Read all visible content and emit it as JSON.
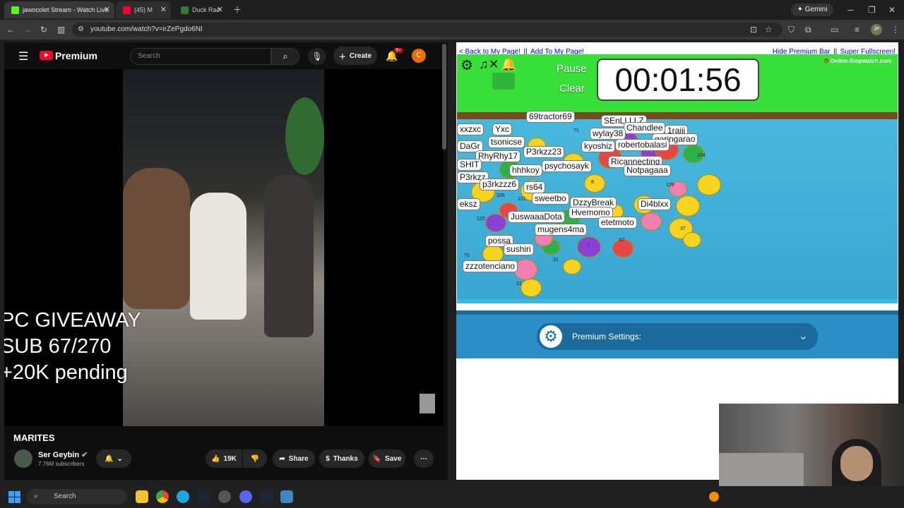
{
  "browser": {
    "tabs": [
      {
        "title": "jawocolet Stream - Watch Live",
        "color": "#53fc18"
      },
      {
        "title": "(45) M",
        "color": "#ff0033"
      },
      {
        "title": "Duck Rac",
        "color": "#2e7d32"
      }
    ],
    "url": "youtube.com/watch?v=irZePgdo6NI",
    "gemini_label": "Gemini",
    "profile_initials": "JP"
  },
  "youtube": {
    "brand": "Premium",
    "search_placeholder": "Search",
    "create_label": "Create",
    "notif_count": "9+",
    "avatar_letter": "C",
    "overlay_lines": [
      "PC GIVEAWAY",
      "SUB 67/270",
      "+20K pending"
    ],
    "video_title": "MARITES",
    "channel_name": "Ser Geybin",
    "subscribers": "7.76M subscribers",
    "likes": "19K",
    "share_label": "Share",
    "thanks_label": "Thanks",
    "save_label": "Save"
  },
  "racepage": {
    "back_link": "< Back to My Page!",
    "sep1": "||",
    "add_link": "Add To My Page!",
    "hide_link": "Hide Premium Bar",
    "sep2": "||",
    "fullscreen_link": "Super Fullscreen!",
    "pause_label": "Pause",
    "clear_label": "Clear",
    "timer": "00:01:56",
    "logo": "Online-Stopwatch.com",
    "premium_settings": "Premium Settings:",
    "duck_names": [
      "69tractor69",
      "SEnLLLLZ",
      "Chandlee",
      "1raiii",
      "xxzxc",
      "Yxc",
      "wylay38",
      "garingarao",
      "tsonicse",
      "DaGr",
      "psychosayk",
      "robertobalasi",
      "P3rkzz23",
      "RhyRhy17",
      "kyoshiz",
      "Ricannecting",
      "Notpagaaa",
      "hhhkoy",
      "SHIT",
      "P3rkzz",
      "p3rkzzz6",
      "rs64",
      "sweetbo",
      "DzzyBreak",
      "Di4blxx",
      "eksz",
      "Hvemomo",
      "JuswaaaDota",
      "etetmoto",
      "mugens4ma",
      "possa",
      "sushiri",
      "zzzotenciano"
    ],
    "duck_numbers": [
      "71",
      "104",
      "8",
      "129",
      "105",
      "121",
      "120",
      "37",
      "67",
      "7",
      "70",
      "31",
      "21"
    ]
  },
  "taskbar": {
    "search_placeholder": "Search"
  }
}
